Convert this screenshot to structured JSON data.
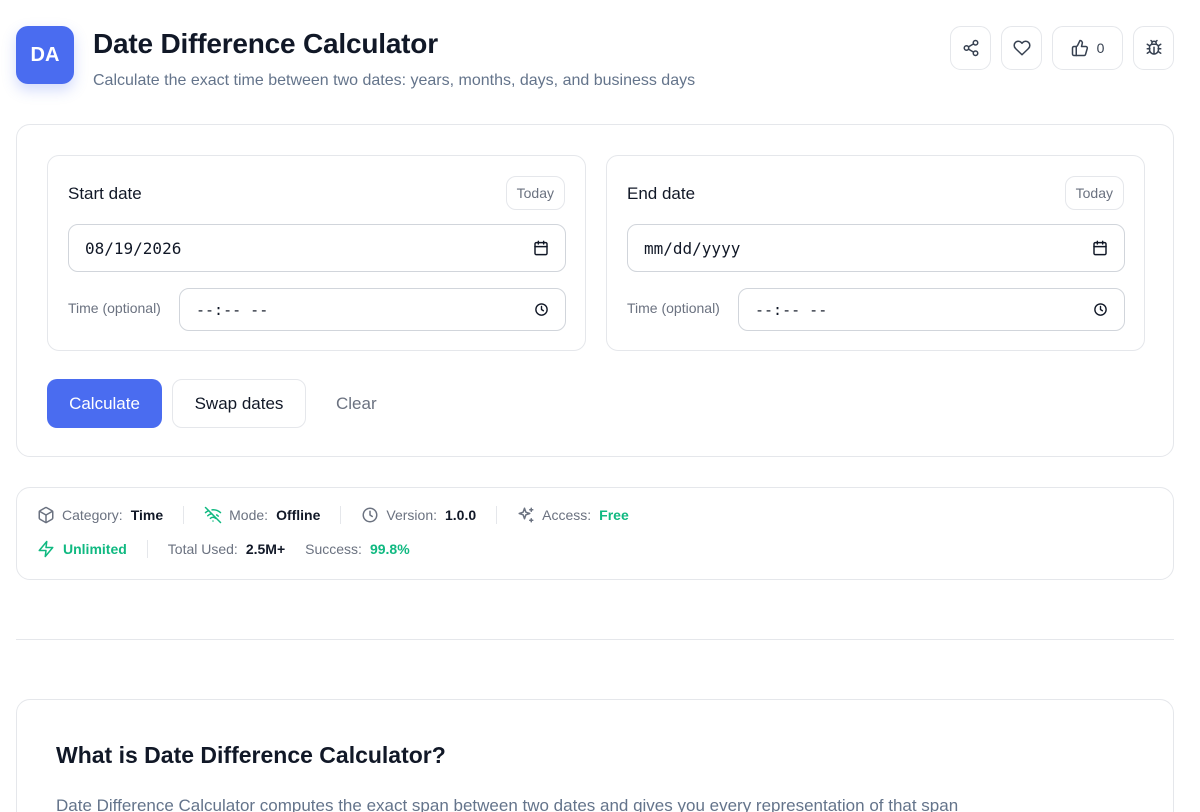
{
  "header": {
    "icon_text": "DA",
    "title": "Date Difference Calculator",
    "subtitle": "Calculate the exact time between two dates: years, months, days, and business days",
    "like_count": "0"
  },
  "start": {
    "label": "Start date",
    "today_label": "Today",
    "date_value": "08/19/2026",
    "time_label": "Time (optional)",
    "time_value": "--:-- --"
  },
  "end": {
    "label": "End date",
    "today_label": "Today",
    "date_value": "mm/dd/yyyy",
    "time_label": "Time (optional)",
    "time_value": "--:-- --"
  },
  "actions": {
    "calculate": "Calculate",
    "swap": "Swap dates",
    "clear": "Clear"
  },
  "meta": {
    "category_label": "Category:",
    "category_value": "Time",
    "mode_label": "Mode:",
    "mode_value": "Offline",
    "version_label": "Version:",
    "version_value": "1.0.0",
    "access_label": "Access:",
    "access_value": "Free",
    "unlimited": "Unlimited",
    "total_label": "Total Used:",
    "total_value": "2.5M+",
    "success_label": "Success:",
    "success_value": "99.8%"
  },
  "about": {
    "title": "What is Date Difference Calculator?",
    "text": "Date Difference Calculator computes the exact span between two dates and gives you every representation of that span"
  },
  "colors": {
    "accent": "#4a6cf0",
    "green": "#10b981",
    "border": "#e5e7eb",
    "muted": "#64748b"
  },
  "icons": [
    "share-icon",
    "heart-icon",
    "thumbs-up-icon",
    "bug-icon",
    "calendar-icon",
    "clock-icon",
    "cube-icon",
    "wifi-off-icon",
    "sparkles-icon",
    "zap-icon"
  ]
}
